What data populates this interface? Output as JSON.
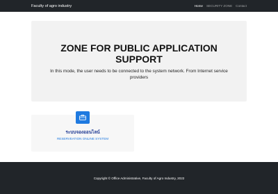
{
  "navbar": {
    "brand": "Faculty of agro industry",
    "links": [
      {
        "label": "Home",
        "active": true
      },
      {
        "label": "SECURITY ZONE",
        "active": false
      },
      {
        "label": "Contact",
        "active": false
      }
    ]
  },
  "hero": {
    "title": "ZONE FOR PUBLIC APPLICATION SUPPORT",
    "description": "In this mode, the user needs to be connected to the system network. From Internet service providers"
  },
  "card": {
    "icon": "briefcase-icon",
    "title_th": "ระบบจองออนไลน์",
    "subtitle": "RESERVEATION ONLINE SYSTEM"
  },
  "footer": {
    "text": "Copyright © Office Administrative, Faculty of Agro Industry, 2022"
  },
  "colors": {
    "navbar_bg": "#212529",
    "accent_blue": "#1f7ae0",
    "hero_bg": "#f2f2f2"
  }
}
